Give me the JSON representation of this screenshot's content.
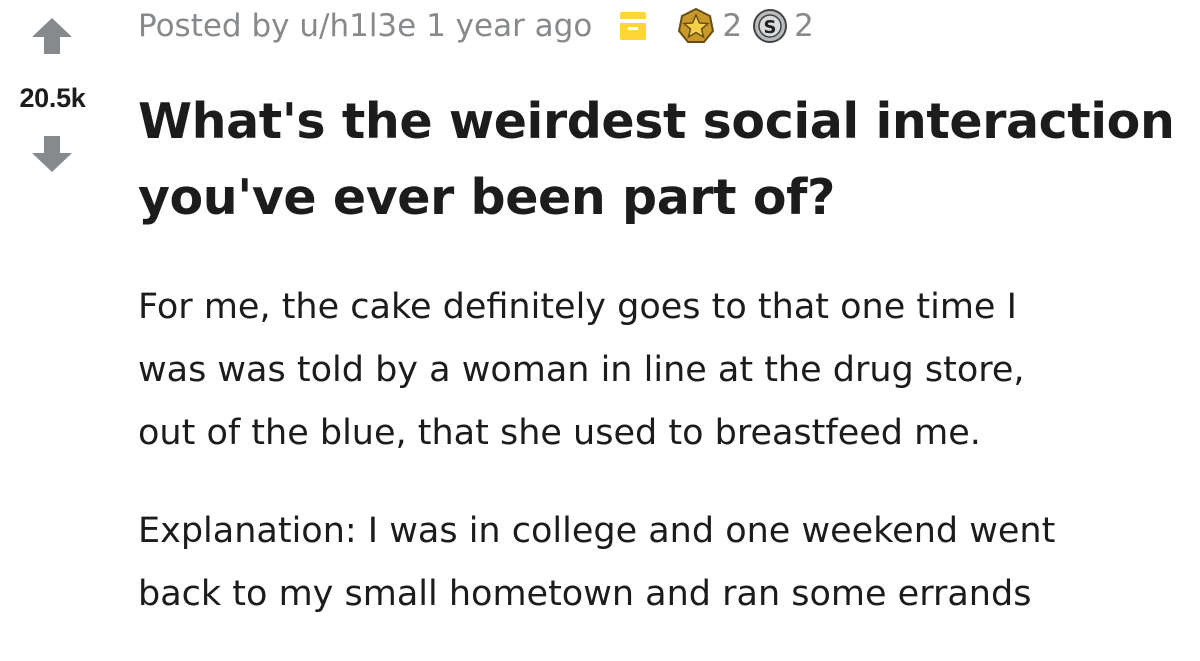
{
  "post": {
    "score": "20.5k",
    "posted_prefix": "Posted by",
    "username": "u/h1l3e",
    "time_ago": "1 year ago",
    "awards": [
      {
        "icon": "gold-award-icon",
        "count": "2"
      },
      {
        "icon": "silver-award-icon",
        "count": "2"
      }
    ],
    "title_lines": [
      "What's the weirdest social interaction",
      "you've ever been part of?"
    ],
    "paragraphs": [
      [
        "For me, the cake definitely goes to that one time I",
        "was was told by a woman in line at the drug store,",
        "out of the blue, that she used to breastfeed me."
      ],
      [
        "Explanation: I was in college and one weekend went",
        "back to my small hometown and ran some errands"
      ]
    ]
  },
  "colors": {
    "arrow": "#878a8c",
    "text": "#1c1c1c",
    "meta": "#878a8c",
    "archive": "#ffd635"
  }
}
